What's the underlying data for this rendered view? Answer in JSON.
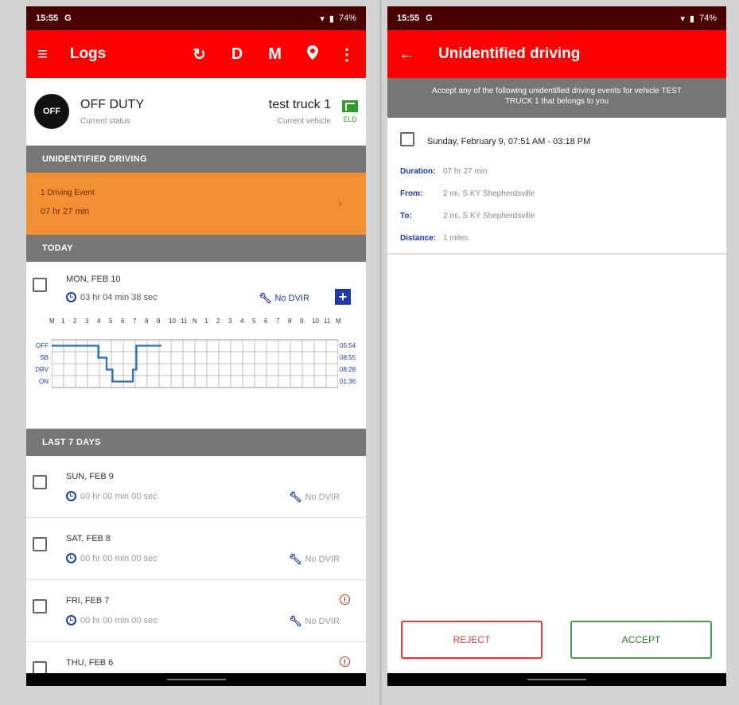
{
  "left": {
    "statusbar": {
      "time": "15:55",
      "g": "G",
      "battery": "74%"
    },
    "appbar": {
      "menu_icon": "≡",
      "title": "Logs",
      "sync_icon": "↻",
      "d_label": "D",
      "m_label": "M",
      "location_icon": "location-pin",
      "more_icon": "⋮"
    },
    "status": {
      "badge": "OFF",
      "title": "OFF DUTY",
      "subtitle": "Current status",
      "vehicle": "test truck 1",
      "vehicle_sub": "Current vehicle",
      "eld_label": "ELD"
    },
    "unidentified": {
      "header": "UNIDENTIFIED DRIVING",
      "line1": "1 Driving Event",
      "line2": "07 hr 27 min",
      "chevron": "›"
    },
    "today": {
      "header": "TODAY",
      "day": "MON, FEB 10",
      "duration": "03 hr 04 min 38 sec",
      "dvir": "No DVIR",
      "plus": "+",
      "hours": [
        "M",
        "1",
        "2",
        "3",
        "4",
        "5",
        "6",
        "7",
        "8",
        "9",
        "10",
        "11",
        "N",
        "1",
        "2",
        "3",
        "4",
        "5",
        "6",
        "7",
        "8",
        "9",
        "10",
        "11",
        "M"
      ],
      "status_labels": [
        "OFF",
        "SB",
        "DRV",
        "ON"
      ],
      "totals": [
        "05:54",
        "08:55",
        "08:28",
        "01:36"
      ],
      "graph_line_color": "#2a6fb5"
    },
    "last7": {
      "header": "LAST 7 DAYS",
      "rows": [
        {
          "day": "SUN, FEB 9",
          "duration": "00 hr 00 min 00 sec",
          "dvir": "No DVIR"
        },
        {
          "day": "SAT, FEB 8",
          "duration": "00 hr 00 min 00 sec",
          "dvir": "No DVIR"
        },
        {
          "day": "FRI, FEB 7",
          "duration": "00 hr 00 min 00 sec",
          "dvir": "No DVIR",
          "alert": "!"
        },
        {
          "day": "THU, FEB 6",
          "alert": "!"
        }
      ]
    }
  },
  "right": {
    "statusbar": {
      "time": "15:55",
      "g": "G",
      "battery": "74%"
    },
    "appbar": {
      "back_icon": "←",
      "title": "Unidentified driving"
    },
    "banner": "Accept any of the following unidentified driving events for vehicle TEST TRUCK 1 that belongs to you",
    "event": {
      "date": "Sunday, February 9, 07:51 AM - 03:18 PM",
      "duration_label": "Duration:",
      "duration": "07 hr 27 min",
      "from_label": "From:",
      "from": "2 mi, S KY Shepherdsville",
      "to_label": "To:",
      "to": "2 mi, S KY Shepherdsville",
      "distance_label": "Distance:",
      "distance": "1 miles"
    },
    "buttons": {
      "reject": "REJECT",
      "accept": "ACCEPT"
    }
  },
  "colors": {
    "appbar": "#ff0000",
    "statusbar": "#4a0000",
    "accent_blue": "#1d39a8",
    "orange": "#f39033",
    "section_gray": "#767676"
  }
}
